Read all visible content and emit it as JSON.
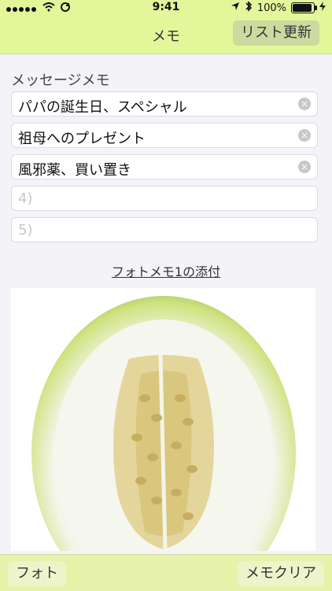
{
  "status_bar": {
    "time": "9:41",
    "battery": "100%",
    "icons": [
      "signal-dots",
      "wifi-icon",
      "sync-icon",
      "location-arrow-icon",
      "bluetooth-icon",
      "battery-icon",
      "charging-icon"
    ]
  },
  "navbar": {
    "title": "メモ",
    "refresh_label": "リスト更新"
  },
  "memo": {
    "section_label": "メッセージメモ",
    "fields": [
      {
        "value": "パパの誕生日、スペシャル",
        "placeholder": ""
      },
      {
        "value": "祖母へのプレゼント",
        "placeholder": ""
      },
      {
        "value": "風邪薬、買い置き",
        "placeholder": ""
      },
      {
        "value": "",
        "placeholder": "4)"
      },
      {
        "value": "",
        "placeholder": "5)"
      }
    ]
  },
  "photo": {
    "link_label": "フォトメモ1の添付",
    "image_subject": "melon-half"
  },
  "bottom_bar": {
    "left_label": "フォト",
    "right_label": "メモクリア"
  },
  "colors": {
    "bar": "#e3f79a",
    "button": "#cdd99f",
    "background": "#f4f4f8"
  }
}
